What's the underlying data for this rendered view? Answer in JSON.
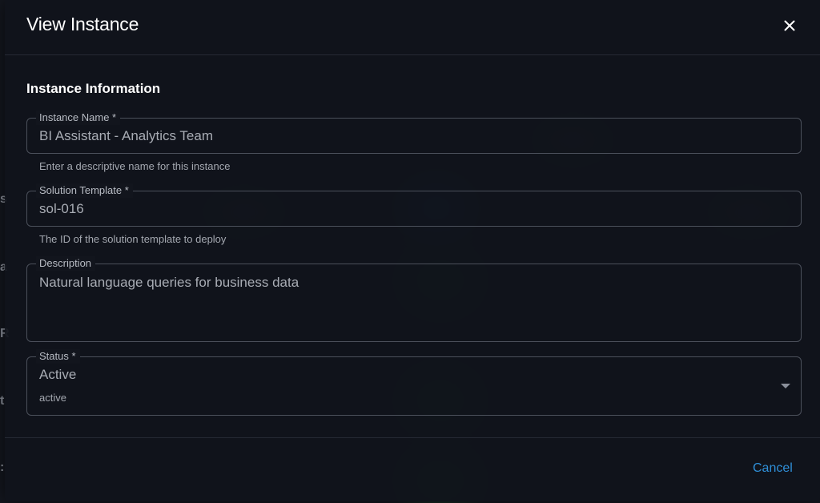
{
  "dialog": {
    "title": "View Instance",
    "close_icon": "close-icon"
  },
  "section": {
    "title": "Instance Information"
  },
  "fields": {
    "instance_name": {
      "label": "Instance Name *",
      "value": "BI Assistant - Analytics Team",
      "helper": "Enter a descriptive name for this instance"
    },
    "solution_template": {
      "label": "Solution Template *",
      "value": "sol-016",
      "helper": "The ID of the solution template to deploy"
    },
    "description": {
      "label": "Description",
      "value": "Natural language queries for business data"
    },
    "status": {
      "label": "Status *",
      "value": "Active",
      "sub": "active",
      "icon": "chevron-down-icon"
    }
  },
  "footer": {
    "cancel_label": "Cancel"
  },
  "colors": {
    "accent": "#2f8fd8",
    "dialog_bg": "#10131b",
    "border": "#4b505b"
  }
}
